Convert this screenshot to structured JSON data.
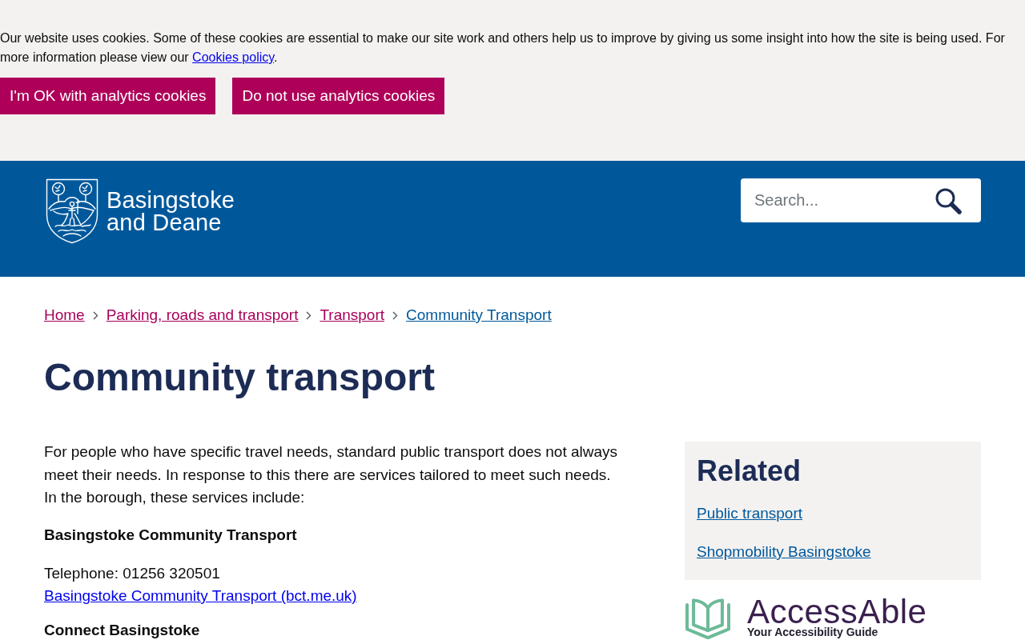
{
  "cookie_banner": {
    "text": "Our website uses cookies. Some of these cookies are essential to make our site work and others help us to improve by giving us some insight into how the site is being used. For more information please view our ",
    "link": "Cookies policy",
    "after_link": ".",
    "buttons": [
      "I'm OK with analytics cookies",
      "Do not use analytics cookies"
    ]
  },
  "header": {
    "site_name": [
      "Basingstoke",
      "and Deane"
    ],
    "search": {
      "placeholder": "Search..."
    }
  },
  "breadcrumb": [
    {
      "label": "Home",
      "current": false
    },
    {
      "label": "Parking, roads and transport",
      "current": false
    },
    {
      "label": "Transport",
      "current": false
    },
    {
      "label": "Community Transport",
      "current": true
    }
  ],
  "title": "Community transport",
  "content": [
    {
      "kind": "paragraph",
      "text": "For people who have specific travel needs, standard public transport does not always meet their needs. In response to this there are services tailored to meet such needs. In the borough, these services include:"
    },
    {
      "kind": "heading",
      "text": "Basingstoke Community Transport"
    },
    {
      "kind": "contact",
      "telephone": "Telephone: 01256 320501",
      "link": "Basingstoke Community Transport (bct.me.uk)"
    },
    {
      "kind": "heading",
      "text": "Connect Basingstoke"
    }
  ],
  "sidebar": {
    "title": "Related",
    "links": [
      "Public transport",
      "Shopmobility Basingstoke"
    ],
    "partner_logo": {
      "name": "AccessAble",
      "tagline": "Your Accessibility Guide"
    }
  }
}
